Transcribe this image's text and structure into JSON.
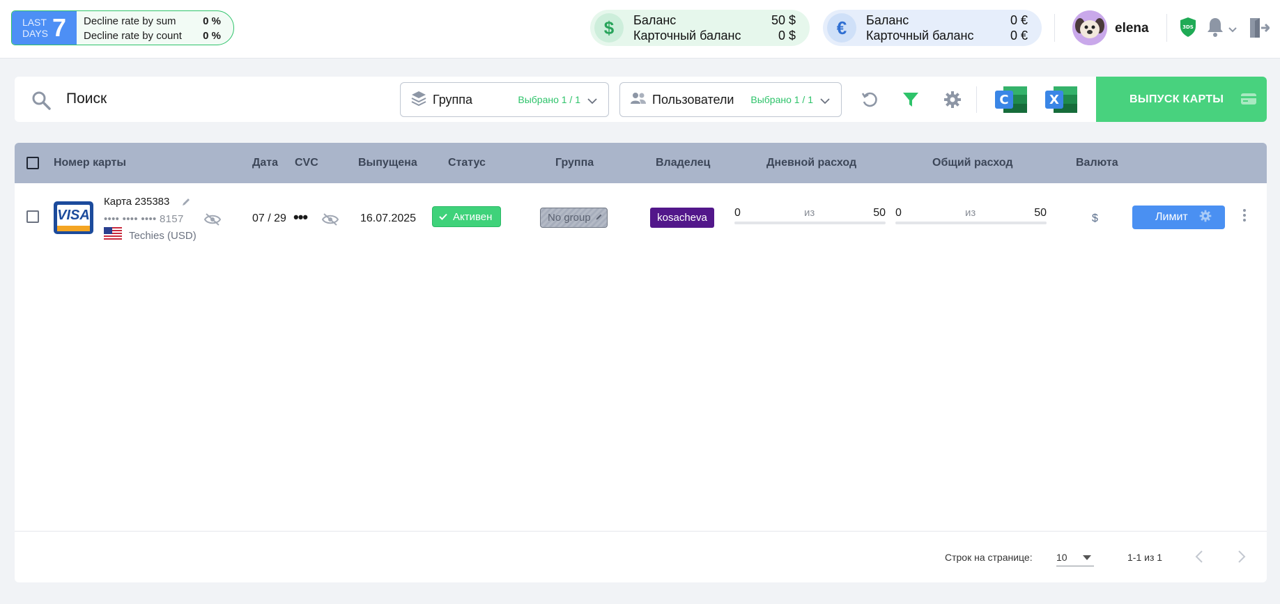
{
  "stats": {
    "last_label": "LAST",
    "days_label": "DAYS",
    "days_value": "7",
    "rows": [
      {
        "label": "Decline rate by sum",
        "value": "0 %"
      },
      {
        "label": "Decline rate by count",
        "value": "0 %"
      }
    ]
  },
  "balances": {
    "usd": {
      "icon": "$",
      "balance_label": "Баланс",
      "balance_value": "50 $",
      "card_label": "Карточный баланс",
      "card_value": "0 $"
    },
    "eur": {
      "icon": "€",
      "balance_label": "Баланс",
      "balance_value": "0 €",
      "card_label": "Карточный баланс",
      "card_value": "0 €"
    }
  },
  "user": {
    "name": "elena",
    "badge_3ds": "3DS"
  },
  "toolbar": {
    "search_placeholder": "Поиск",
    "group_label": "Группа",
    "group_count": "Выбрано 1 / 1",
    "users_label": "Пользователи",
    "users_count": "Выбрано 1 / 1",
    "csv_letter": "C",
    "xls_letter": "X",
    "issue_button": "ВЫПУСК КАРТЫ"
  },
  "table": {
    "headers": {
      "card": "Номер карты",
      "date": "Дата",
      "cvc": "CVC",
      "issued": "Выпущена",
      "status": "Статус",
      "group": "Группа",
      "owner": "Владелец",
      "daily": "Дневной расход",
      "total": "Общий расход",
      "currency": "Валюта"
    },
    "rows": [
      {
        "brand": "VISA",
        "card_name": "Карта 235383",
        "card_number": "•••• •••• •••• 8157",
        "region": "Techies (USD)",
        "date": "07 / 29",
        "cvc": "•••",
        "issued": "16.07.2025",
        "status": "Активен",
        "group": "No group",
        "owner": "kosacheva",
        "daily": {
          "spent": "0",
          "of": "из",
          "limit": "50",
          "fraction": 0
        },
        "total": {
          "spent": "0",
          "of": "из",
          "limit": "50",
          "fraction": 0
        },
        "currency": "$",
        "limit_button": "Лимит"
      }
    ]
  },
  "pagination": {
    "rows_per_page_label": "Строк на странице:",
    "rows_per_page_value": "10",
    "range": "1-1 из 1"
  },
  "colors": {
    "accent_green": "#48d27e",
    "accent_blue": "#4a90f2",
    "header_bg": "#aab5ca",
    "owner_badge": "#52178a"
  }
}
